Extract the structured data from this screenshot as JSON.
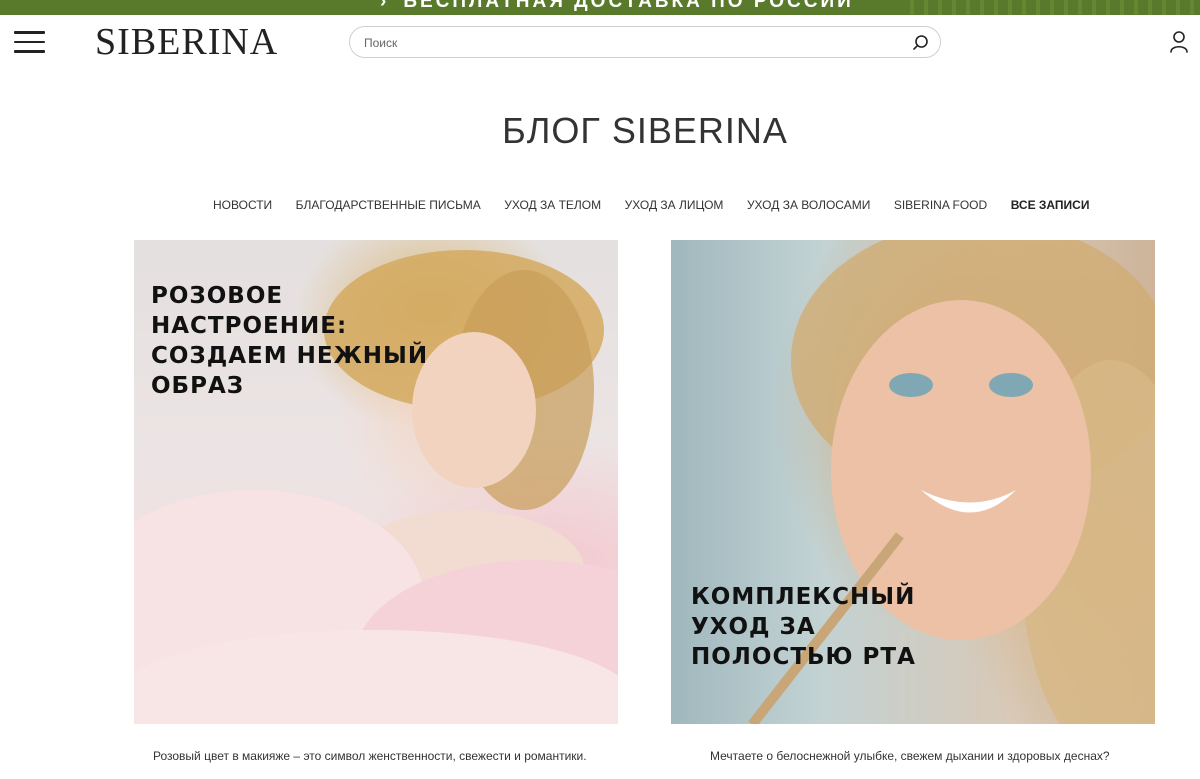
{
  "promo": {
    "text": "БЕСПЛАТНАЯ ДОСТАВКА ПО РОССИИ",
    "color": "#5a7a2b"
  },
  "header": {
    "logo": "SIBERINA",
    "search": {
      "placeholder": "Поиск",
      "value": ""
    },
    "icons": [
      "menu-icon",
      "search-icon",
      "user-icon"
    ]
  },
  "page": {
    "title": "БЛОГ SIBERINA"
  },
  "categories": [
    {
      "label": "НОВОСТИ",
      "active": false
    },
    {
      "label": "БЛАГОДАРСТВЕННЫЕ ПИСЬМА",
      "active": false
    },
    {
      "label": "УХОД ЗА ТЕЛОМ",
      "active": false
    },
    {
      "label": "УХОД ЗА ЛИЦОМ",
      "active": false
    },
    {
      "label": "УХОД ЗА ВОЛОСАМИ",
      "active": false
    },
    {
      "label": "SIBERINA FOOD",
      "active": false
    },
    {
      "label": "ВСЕ ЗАПИСИ",
      "active": true
    }
  ],
  "posts": [
    {
      "heading": "РОЗОВОЕ НАСТРОЕНИЕ: СОЗДАЕМ НЕЖНЫЙ ОБРАЗ",
      "excerpt": "Розовый цвет в макияже – это символ женственности, свежести и романтики.",
      "image": "woman-in-pink-clouds"
    },
    {
      "heading": "КОМПЛЕКСНЫЙ УХОД ЗА ПОЛОСТЬЮ РТА",
      "excerpt": "Мечтаете о белоснежной улыбке, свежем дыхании и здоровых деснах?",
      "image": "woman-with-bamboo-toothbrush"
    }
  ]
}
